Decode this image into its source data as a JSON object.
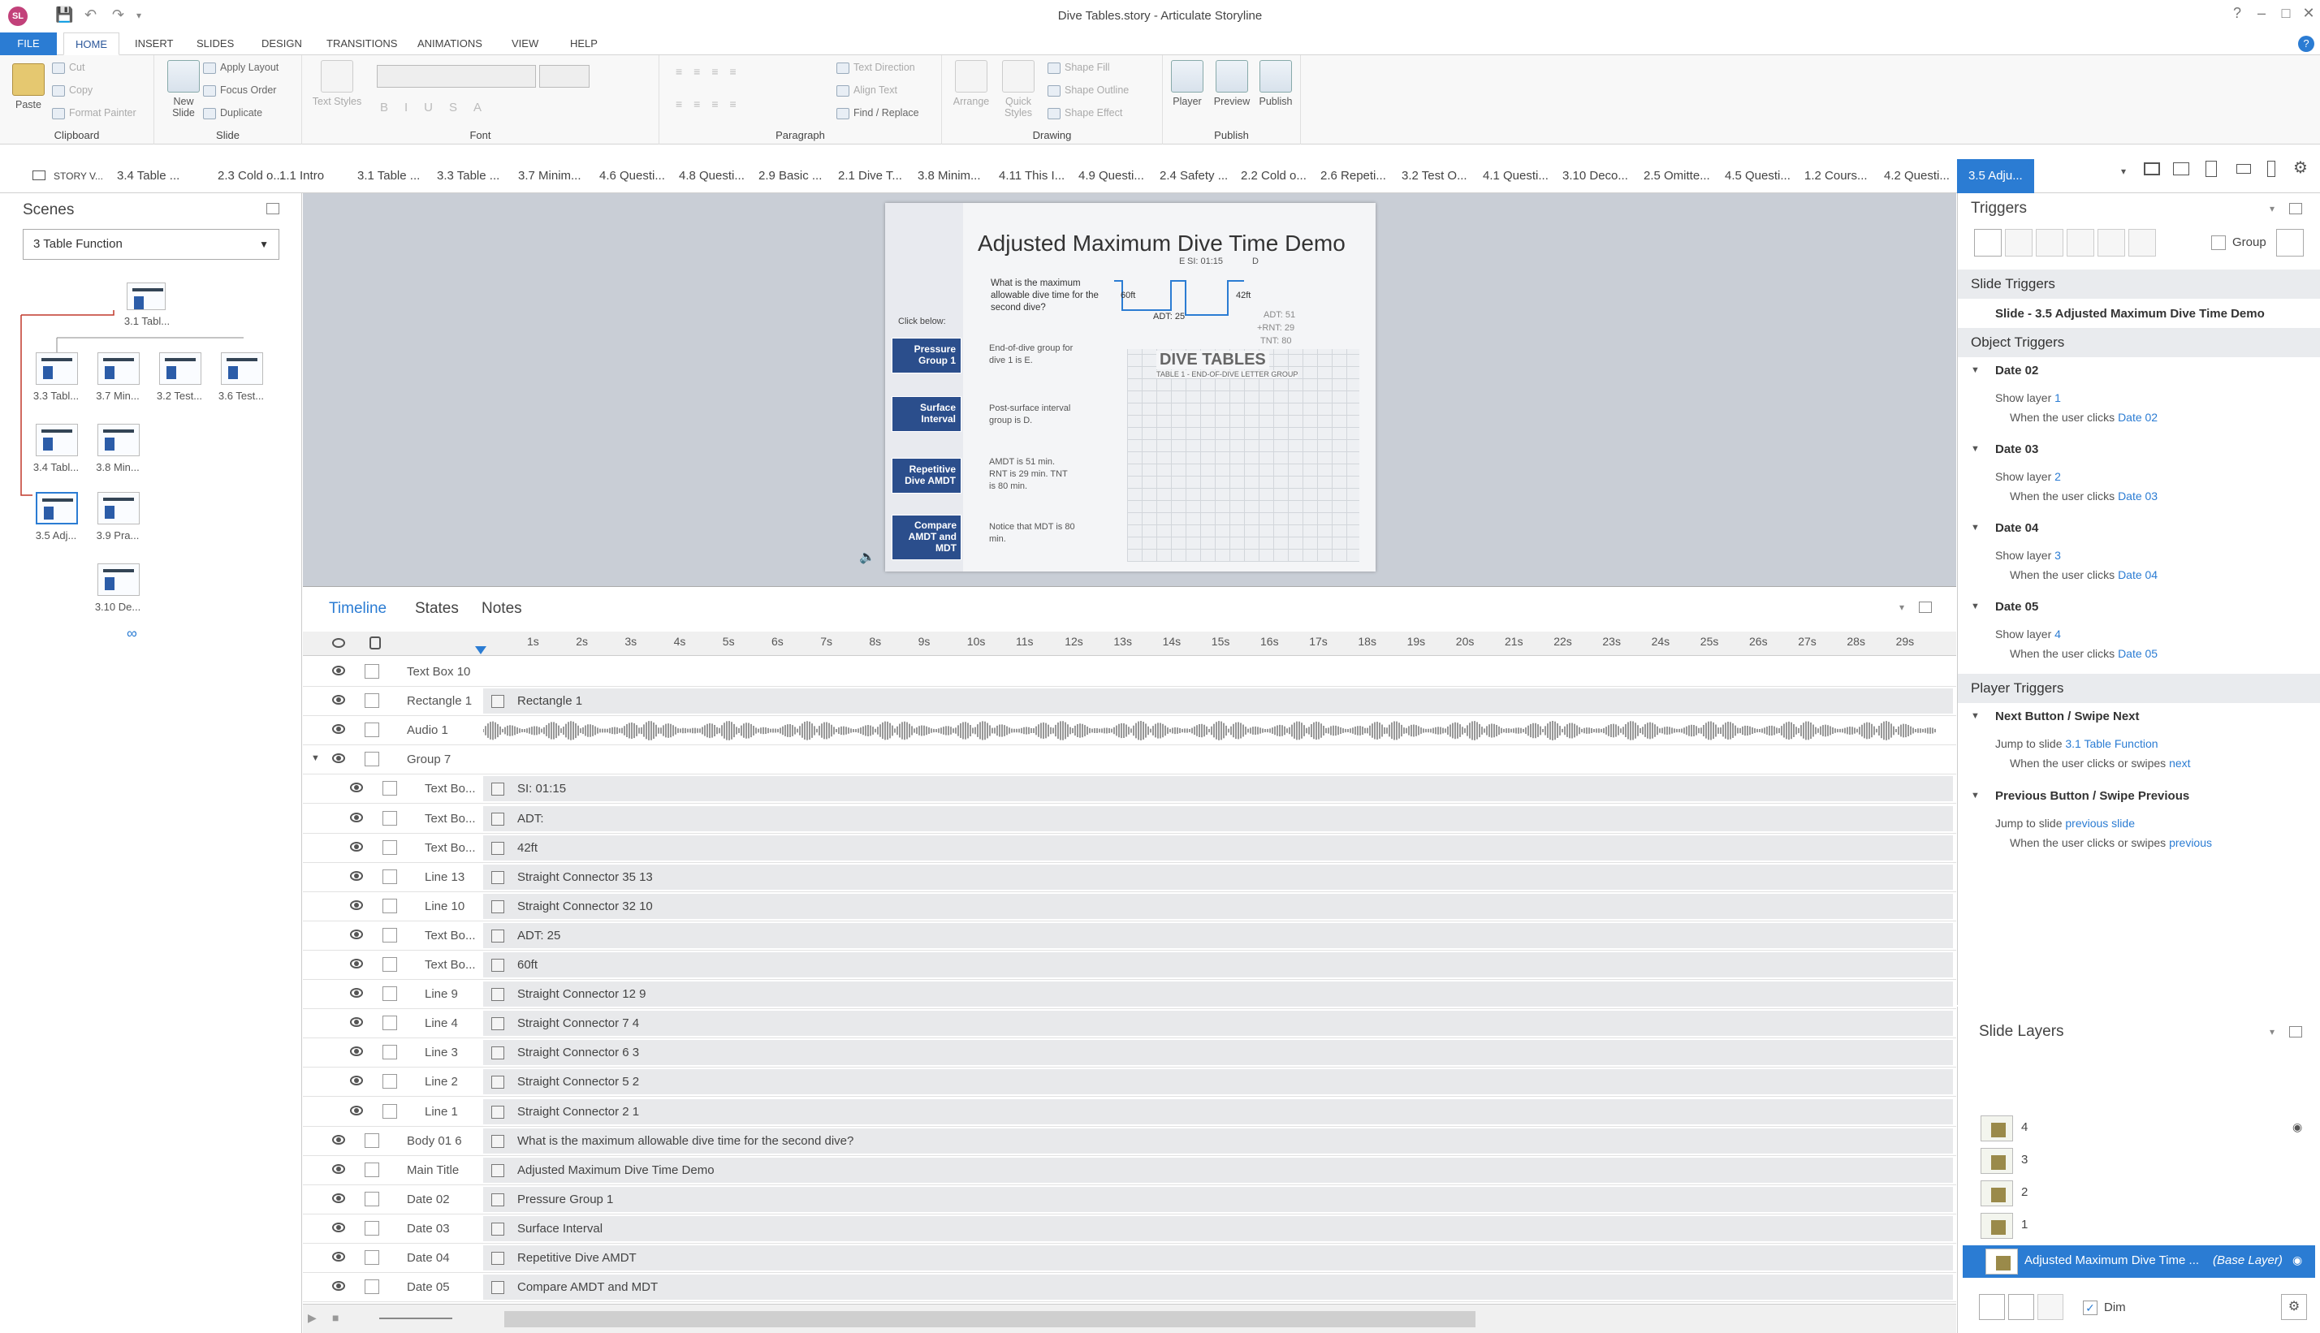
{
  "window": {
    "title": "Dive Tables.story - Articulate Storyline"
  },
  "ribbon_tabs": [
    {
      "label": "FILE"
    },
    {
      "label": "HOME"
    },
    {
      "label": "INSERT"
    },
    {
      "label": "SLIDES"
    },
    {
      "label": "DESIGN"
    },
    {
      "label": "TRANSITIONS"
    },
    {
      "label": "ANIMATIONS"
    },
    {
      "label": "VIEW"
    },
    {
      "label": "HELP"
    }
  ],
  "ribbon": {
    "clipboard": {
      "paste": "Paste",
      "cut": "Cut",
      "copy": "Copy",
      "format_painter": "Format Painter",
      "label": "Clipboard"
    },
    "slide": {
      "new_slide": "New Slide",
      "apply_layout": "Apply Layout",
      "focus_order": "Focus Order",
      "duplicate": "Duplicate",
      "label": "Slide"
    },
    "font": {
      "text_styles": "Text Styles",
      "label": "Font"
    },
    "paragraph": {
      "text_direction": "Text Direction",
      "align_text": "Align Text",
      "find_replace": "Find / Replace",
      "label": "Paragraph"
    },
    "drawing": {
      "arrange": "Arrange",
      "quick_styles": "Quick Styles",
      "shape_fill": "Shape Fill",
      "shape_outline": "Shape Outline",
      "shape_effect": "Shape Effect",
      "label": "Drawing"
    },
    "publish": {
      "player": "Player",
      "preview": "Preview",
      "publish": "Publish",
      "label": "Publish"
    }
  },
  "slide_tabs": [
    "STORY V...",
    "3.4 Table ...",
    "2.3 Cold o...",
    "1.1 Intro",
    "3.1 Table ...",
    "3.3 Table ...",
    "3.7 Minim...",
    "4.6 Questi...",
    "4.8 Questi...",
    "2.9 Basic ...",
    "2.1 Dive T...",
    "3.8 Minim...",
    "4.11 This I...",
    "4.9 Questi...",
    "2.4 Safety ...",
    "2.2 Cold o...",
    "2.6 Repeti...",
    "3.2 Test O...",
    "4.1 Questi...",
    "3.10 Deco...",
    "2.5 Omitte...",
    "4.5 Questi...",
    "1.2 Cours...",
    "4.2 Questi...",
    "3.5 Adju..."
  ],
  "scenes": {
    "title": "Scenes",
    "selected_scene": "3 Table Function",
    "slides": [
      "3.1 Tabl...",
      "3.3 Tabl...",
      "3.7 Min...",
      "3.2 Test...",
      "3.6 Test...",
      "3.4 Tabl...",
      "3.8 Min...",
      "3.5 Adj...",
      "3.9 Pra...",
      "3.10 De..."
    ]
  },
  "slide": {
    "title": "Adjusted Maximum Dive Time Demo",
    "question": "What is the maximum allowable dive time for the second dive?",
    "click_below": "Click below:",
    "buttons": [
      "Pressure Group 1",
      "Surface Interval",
      "Repetitive Dive AMDT",
      "Compare AMDT and MDT"
    ],
    "notes": [
      "End-of-dive group for dive 1 is E.",
      "Post-surface interval group is D.",
      "AMDT is 51 min. RNT is 29 min. TNT is 80 min.",
      "Notice that MDT is 80 min."
    ],
    "diagram": {
      "si": "SI: 01:15",
      "e": "E",
      "d": "D",
      "d60": "60ft",
      "d42": "42ft",
      "adt25": "ADT: 25",
      "adt51": "ADT: 51",
      "rnt": "+RNT: 29",
      "tnt": "TNT: 80"
    },
    "table_title": "DIVE TABLES",
    "table_subtitle": "TABLE 1 - END-OF-DIVE LETTER GROUP"
  },
  "timeline": {
    "tabs": [
      "Timeline",
      "States",
      "Notes"
    ],
    "ticks": [
      "1s",
      "2s",
      "3s",
      "4s",
      "5s",
      "6s",
      "7s",
      "8s",
      "9s",
      "10s",
      "11s",
      "12s",
      "13s",
      "14s",
      "15s",
      "16s",
      "17s",
      "18s",
      "19s",
      "20s",
      "21s",
      "22s",
      "23s",
      "24s",
      "25s",
      "26s",
      "27s",
      "28s",
      "29s"
    ],
    "rows": [
      {
        "name": "Text Box 10",
        "bar": "",
        "indent": 0
      },
      {
        "name": "Rectangle 1",
        "bar": "Rectangle 1",
        "indent": 0
      },
      {
        "name": "Audio 1",
        "bar": "",
        "indent": 0,
        "audio": true
      },
      {
        "name": "Group 7",
        "bar": "",
        "indent": 0,
        "group": true
      },
      {
        "name": "Text Bo...",
        "bar": "SI: 01:15",
        "indent": 1
      },
      {
        "name": "Text Bo...",
        "bar": "ADT:",
        "indent": 1
      },
      {
        "name": "Text Bo...",
        "bar": "42ft",
        "indent": 1
      },
      {
        "name": "Line 13",
        "bar": "Straight Connector 35 13",
        "indent": 1
      },
      {
        "name": "Line 10",
        "bar": "Straight Connector 32 10",
        "indent": 1
      },
      {
        "name": "Text Bo...",
        "bar": "ADT: 25",
        "indent": 1
      },
      {
        "name": "Text Bo...",
        "bar": "60ft",
        "indent": 1
      },
      {
        "name": "Line 9",
        "bar": "Straight Connector 12 9",
        "indent": 1
      },
      {
        "name": "Line 4",
        "bar": "Straight Connector 7 4",
        "indent": 1
      },
      {
        "name": "Line 3",
        "bar": "Straight Connector 6 3",
        "indent": 1
      },
      {
        "name": "Line 2",
        "bar": "Straight Connector 5 2",
        "indent": 1
      },
      {
        "name": "Line 1",
        "bar": "Straight Connector 2 1",
        "indent": 1
      },
      {
        "name": "Body 01 6",
        "bar": "What is the maximum allowable dive time for the second dive?",
        "indent": 0
      },
      {
        "name": "Main Title",
        "bar": "Adjusted Maximum Dive Time Demo",
        "indent": 0
      },
      {
        "name": "Date 02",
        "bar": "Pressure Group 1",
        "indent": 0
      },
      {
        "name": "Date 03",
        "bar": "Surface Interval",
        "indent": 0
      },
      {
        "name": "Date 04",
        "bar": "Repetitive Dive AMDT",
        "indent": 0
      },
      {
        "name": "Date 05",
        "bar": "Compare AMDT and MDT",
        "indent": 0
      }
    ]
  },
  "triggers": {
    "title": "Triggers",
    "group_label": "Group",
    "slide_triggers": "Slide Triggers",
    "slide_item": "Slide - 3.5 Adjusted Maximum Dive Time Demo",
    "object_triggers": "Object Triggers",
    "objects": [
      {
        "name": "Date 02",
        "action": "Show layer ",
        "target": "1",
        "when": "When the user clicks ",
        "obj": "Date 02"
      },
      {
        "name": "Date 03",
        "action": "Show layer ",
        "target": "2",
        "when": "When the user clicks ",
        "obj": "Date 03"
      },
      {
        "name": "Date 04",
        "action": "Show layer ",
        "target": "3",
        "when": "When the user clicks ",
        "obj": "Date 04"
      },
      {
        "name": "Date 05",
        "action": "Show layer ",
        "target": "4",
        "when": "When the user clicks ",
        "obj": "Date 05"
      }
    ],
    "player_triggers": "Player Triggers",
    "players": [
      {
        "name": "Next Button / Swipe Next",
        "action": "Jump to slide ",
        "target": "3.1 Table Function",
        "when": "When the user clicks or swipes ",
        "obj": "next"
      },
      {
        "name": "Previous Button / Swipe Previous",
        "action": "Jump to slide ",
        "target": "previous slide",
        "when": "When the user clicks or swipes ",
        "obj": "previous"
      }
    ]
  },
  "layers": {
    "title": "Slide Layers",
    "items": [
      "4",
      "3",
      "2",
      "1"
    ],
    "base": "Adjusted Maximum Dive Time ...",
    "base_tag": "(Base Layer)",
    "dim": "Dim"
  },
  "colors": {
    "accent": "#2b7cd3",
    "slide_button": "#2b4e8c"
  }
}
